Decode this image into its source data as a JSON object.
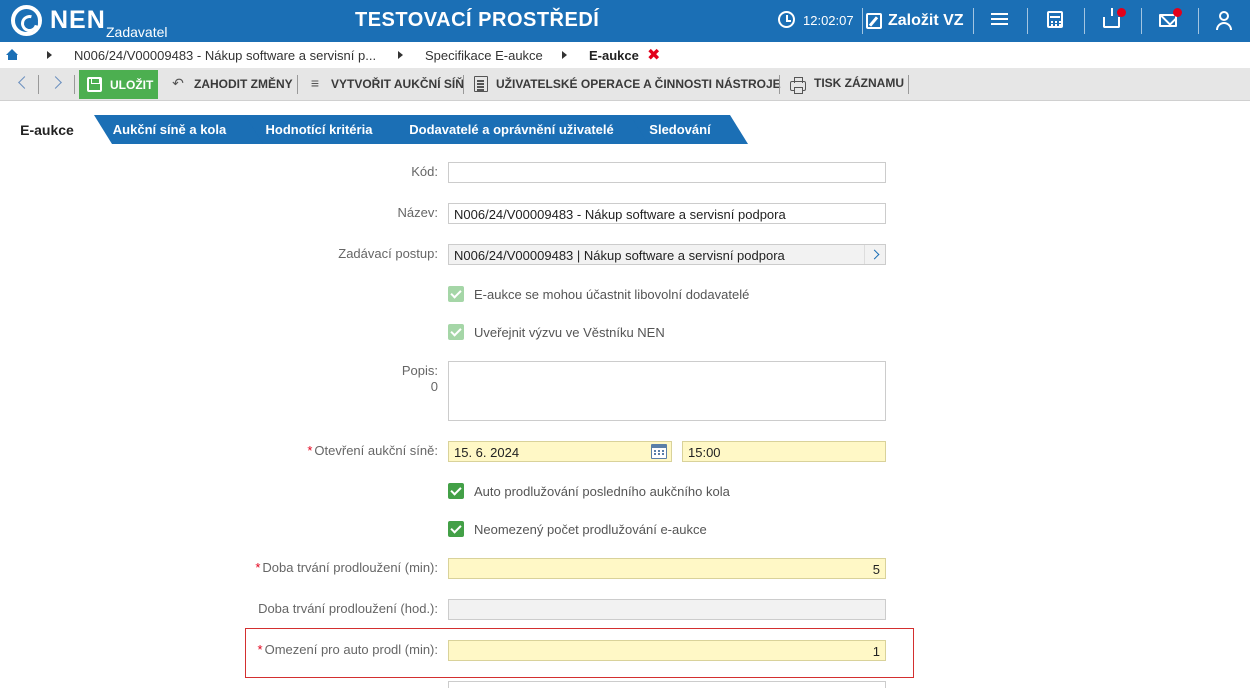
{
  "header": {
    "logo_text": "NEN",
    "logo_sub": "Zadavatel",
    "env_title": "TESTOVACÍ PROSTŘEDÍ",
    "time": "12:02:07",
    "create_label": "Založit VZ",
    "colors": {
      "brand": "#1b6fb5",
      "notification": "#e3001b"
    }
  },
  "breadcrumb": {
    "items": [
      "N006/24/V00009483 - Nákup software a servisní p...",
      "Specifikace E-aukce",
      "E-aukce"
    ]
  },
  "toolbar": {
    "save_label": "ULOŽIT",
    "discard_label": "ZAHODIT ZMĚNY",
    "create_hall_label": "VYTVOŘIT AUKČNÍ SÍŇ",
    "user_ops_label": "UŽIVATELSKÉ OPERACE A ČINNOSTI NÁSTROJE",
    "print_label": "TISK ZÁZNAMU",
    "save_color": "#4caf50"
  },
  "tabs": [
    {
      "label": "E-aukce",
      "active": true
    },
    {
      "label": "Aukční síně a kola",
      "active": false
    },
    {
      "label": "Hodnotící kritéria",
      "active": false
    },
    {
      "label": "Dodavatelé a oprávnění uživatelé",
      "active": false
    },
    {
      "label": "Sledování",
      "active": false
    }
  ],
  "form": {
    "code_label": "Kód:",
    "code_value": "",
    "name_label": "Název:",
    "name_value": "N006/24/V00009483 - Nákup software a servisní podpora",
    "procedure_label": "Zadávací postup:",
    "procedure_value": "N006/24/V00009483 | Nákup software a servisní podpora",
    "chk_any_supplier": "E-aukce se mohou účastnit libovolní dodavatelé",
    "chk_publish": "Uveřejnit výzvu ve Věstníku NEN",
    "description_label": "Popis:",
    "description_count": "0",
    "opening_label": "Otevření aukční síně:",
    "opening_date": "15. 6. 2024",
    "opening_time": "15:00",
    "chk_auto_extend": "Auto prodlužování posledního aukčního kola",
    "chk_unlimited": "Neomezený počet prodlužování e-aukce",
    "ext_min_label": "Doba trvání prodloužení (min):",
    "ext_min_value": "5",
    "ext_hours_label": "Doba trvání prodloužení (hod.):",
    "ext_hours_value": "",
    "limit_label": "Omezení pro auto prodl (min):",
    "limit_value": "1"
  }
}
